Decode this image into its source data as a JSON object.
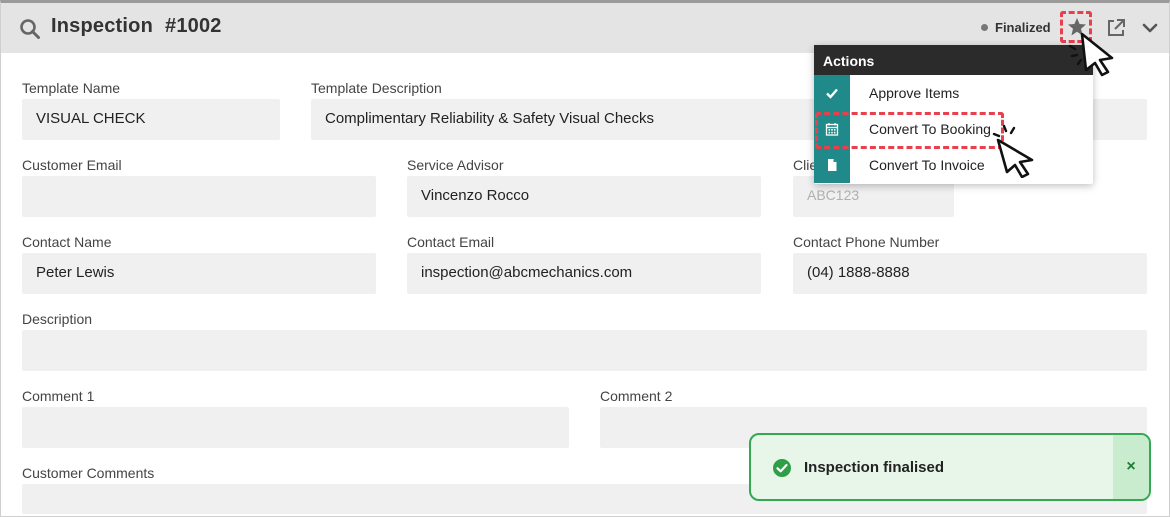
{
  "header": {
    "title": "Inspection",
    "number": "#1002",
    "status": "Finalized",
    "icons": {
      "search": "search-icon",
      "favorite": "star-icon",
      "open": "external-link-icon",
      "collapse": "chevron-down-icon"
    }
  },
  "form": {
    "template_name": {
      "label": "Template Name",
      "value": "VISUAL CHECK"
    },
    "template_description": {
      "label": "Template Description",
      "value": "Complimentary Reliability & Safety Visual Checks"
    },
    "customer_email": {
      "label": "Customer Email",
      "value": ""
    },
    "service_advisor": {
      "label": "Service Advisor",
      "value": "Vincenzo Rocco"
    },
    "client_ref": {
      "label": "Clie",
      "placeholder": "ABC123"
    },
    "contact_name": {
      "label": "Contact Name",
      "value": "Peter Lewis"
    },
    "contact_email": {
      "label": "Contact Email",
      "value": "inspection@abcmechanics.com"
    },
    "contact_phone": {
      "label": "Contact Phone Number",
      "value": "(04) 1888-8888"
    },
    "description": {
      "label": "Description",
      "value": ""
    },
    "comment1": {
      "label": "Comment 1",
      "value": ""
    },
    "comment2": {
      "label": "Comment 2",
      "value": ""
    },
    "customer_comments": {
      "label": "Customer Comments",
      "value": ""
    }
  },
  "actions_menu": {
    "title": "Actions",
    "items": [
      {
        "label": "Approve Items",
        "icon": "check-icon"
      },
      {
        "label": "Convert To Booking",
        "icon": "calendar-icon"
      },
      {
        "label": "Convert To Invoice",
        "icon": "document-icon"
      }
    ]
  },
  "toast": {
    "message": "Inspection finalised",
    "close": "×",
    "icon": "check-circle-icon"
  },
  "colors": {
    "accent_teal": "#1f8a89",
    "highlight_red": "#e8404c",
    "success_green": "#34a853",
    "header_bg": "#e4e4e4"
  }
}
